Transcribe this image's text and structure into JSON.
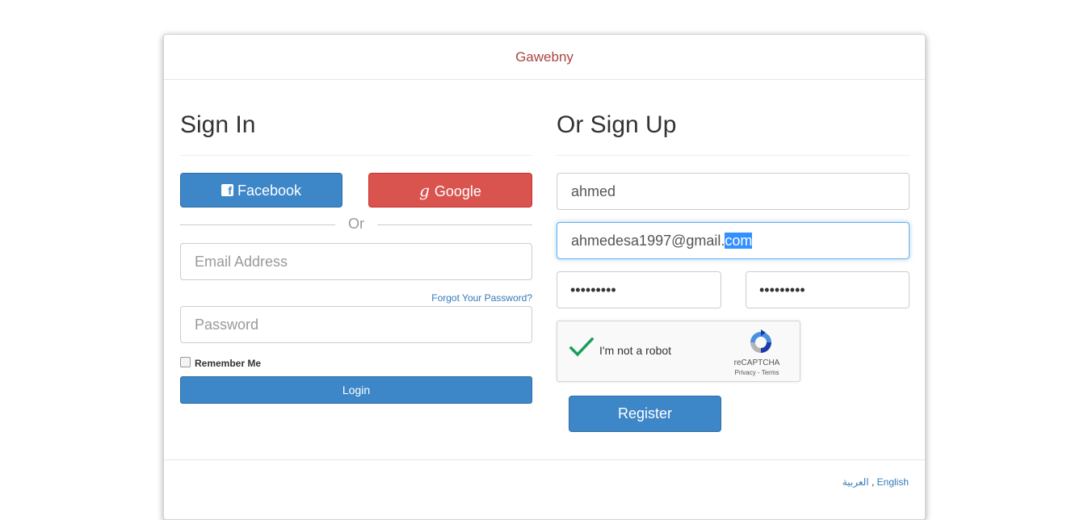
{
  "header": {
    "title": "Gawebny"
  },
  "signin": {
    "heading": "Sign In",
    "facebook_label": "Facebook",
    "google_label": "Google",
    "or_label": "Or",
    "email_placeholder": "Email Address",
    "forgot_label": "Forgot Your Password?",
    "password_placeholder": "Password",
    "remember_label": "Remember Me",
    "remember_checked": false,
    "login_label": "Login"
  },
  "signup": {
    "heading": "Or Sign Up",
    "name_value": "ahmed",
    "email_value_unselected": "ahmedesa1997@gmail.",
    "email_value_selected": "com",
    "password_mask": "•••••••••",
    "confirm_mask": "•••••••••",
    "captcha": {
      "label": "I'm not a robot",
      "checked": true,
      "brand": "reCAPTCHA",
      "terms": "Privacy - Terms"
    },
    "register_label": "Register"
  },
  "footer": {
    "lang_arabic": "العربية",
    "separator": " , ",
    "lang_english": "English"
  },
  "colors": {
    "brand": "#a94442",
    "primary": "#3d87c9",
    "danger": "#d9534f",
    "link": "#337ab7",
    "check": "#1a9f5b"
  },
  "icons": [
    "facebook-icon",
    "google-icon",
    "checkmark-icon",
    "recaptcha-logo-icon"
  ]
}
